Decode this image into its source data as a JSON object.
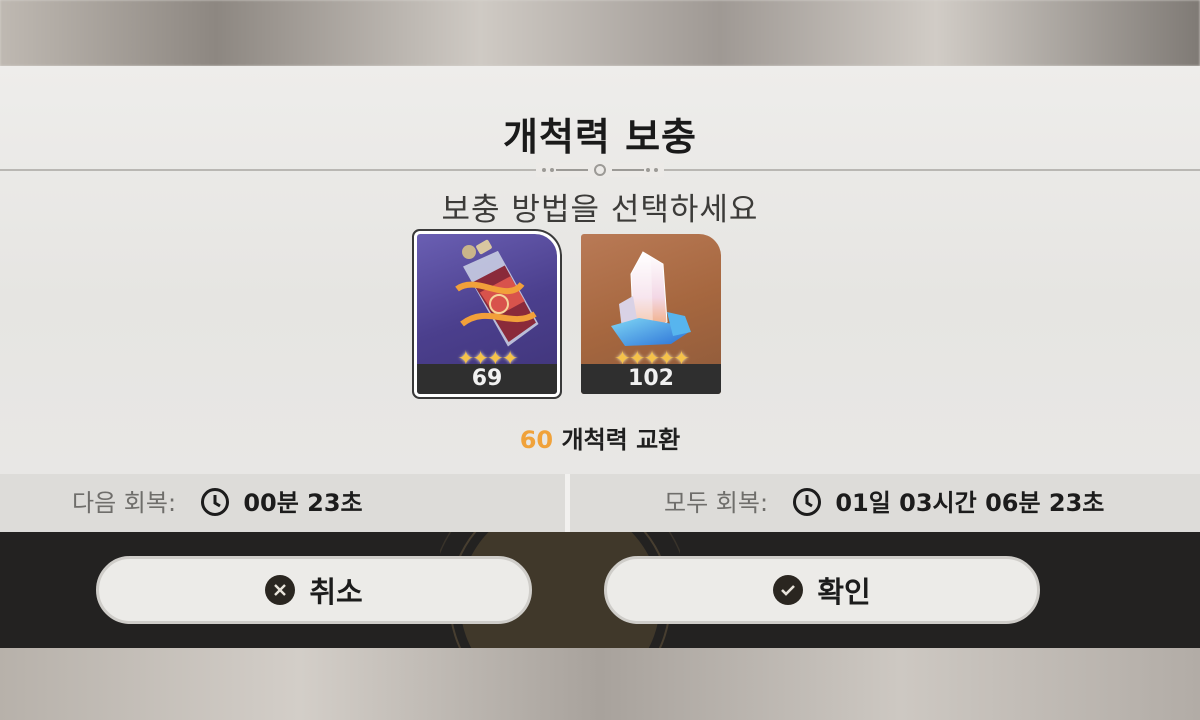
{
  "dialog": {
    "title": "개척력 보충",
    "subtitle": "보충 방법을 선택하세요"
  },
  "items": [
    {
      "name": "fuel",
      "count": "69",
      "stars": "✦✦✦✦",
      "selected": true
    },
    {
      "name": "stellar-jade",
      "count": "102",
      "stars": "✦✦✦✦✦",
      "selected": false
    }
  ],
  "exchange": {
    "amount": "60",
    "text": "개척력 교환"
  },
  "recovery": {
    "next_label": "다음 회복:",
    "next_time": "00분 23초",
    "full_label": "모두 회복:",
    "full_time": "01일 03시간 06분 23초"
  },
  "buttons": {
    "cancel_label": "취소",
    "confirm_label": "확인"
  },
  "colors": {
    "accent": "#f0a23a",
    "fuel_card": "#4b3f8d",
    "jade_card": "#a6673f",
    "star": "#f5c24a"
  }
}
